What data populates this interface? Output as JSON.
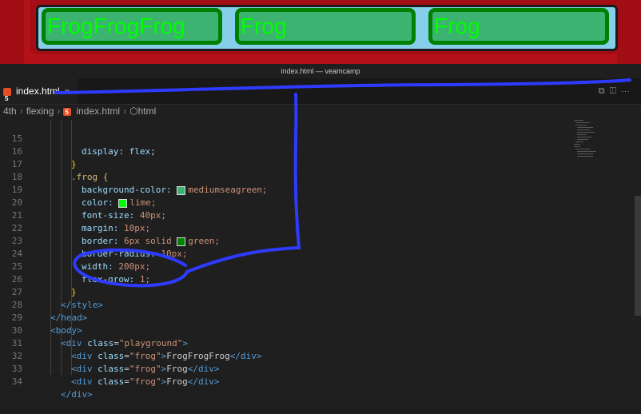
{
  "preview": {
    "frogs": [
      {
        "label": "FrogFrogFrog"
      },
      {
        "label": "Frog"
      },
      {
        "label": "Frog"
      }
    ],
    "colors": {
      "background": "#b3121a",
      "playground": "#87ceeb",
      "frog_bg": "#3cb371",
      "frog_text": "#00ff00",
      "frog_border": "#008000"
    }
  },
  "window": {
    "title": "index.html — veamcamp"
  },
  "tab": {
    "label": "index.html",
    "close": "×",
    "icon": "html5-icon"
  },
  "breadcrumb": {
    "parts": [
      "4th",
      "flexing",
      "index.html",
      "html"
    ]
  },
  "code": {
    "lines": [
      {
        "n": "15",
        "text": "display: flex;"
      },
      {
        "n": "16",
        "text": "}"
      },
      {
        "n": "17",
        "text": ".frog {"
      },
      {
        "n": "18",
        "prop": "background-color:",
        "val": "mediumseagreen;",
        "swatch": "#3cb371"
      },
      {
        "n": "19",
        "prop": "color:",
        "val": "lime;",
        "swatch": "#00ff00"
      },
      {
        "n": "20",
        "prop": "font-size:",
        "val": "40px;"
      },
      {
        "n": "21",
        "prop": "margin:",
        "val": "10px;"
      },
      {
        "n": "22",
        "prop": "border:",
        "val": "6px solid",
        "val2": "green;",
        "swatch": "#008000"
      },
      {
        "n": "23",
        "prop": "border-radius:",
        "val": "10px;"
      },
      {
        "n": "24",
        "prop": "width:",
        "val": "200px;"
      },
      {
        "n": "25",
        "prop": "flex-grow:",
        "val": "1;"
      },
      {
        "n": "26",
        "text": "}"
      },
      {
        "n": "27",
        "text": "</style>"
      },
      {
        "n": "28",
        "text": "</head>"
      },
      {
        "n": "29",
        "text": "<body>"
      },
      {
        "n": "30",
        "a": "<div ",
        "b": "class",
        "c": "=",
        "d": "\"playground\"",
        "e": ">"
      },
      {
        "n": "31",
        "a": "<div ",
        "b": "class",
        "c": "=",
        "d": "\"frog\"",
        "e": ">",
        "f": "FrogFrogFrog",
        "g": "</div>"
      },
      {
        "n": "32",
        "a": "<div ",
        "b": "class",
        "c": "=",
        "d": "\"frog\"",
        "e": ">",
        "f": "Frog",
        "g": "</div>"
      },
      {
        "n": "33",
        "a": "<div ",
        "b": "class",
        "c": "=",
        "d": "\"frog\"",
        "e": ">",
        "f": "Frog",
        "g": "</div>"
      },
      {
        "n": "34",
        "text": "</div>"
      }
    ]
  }
}
